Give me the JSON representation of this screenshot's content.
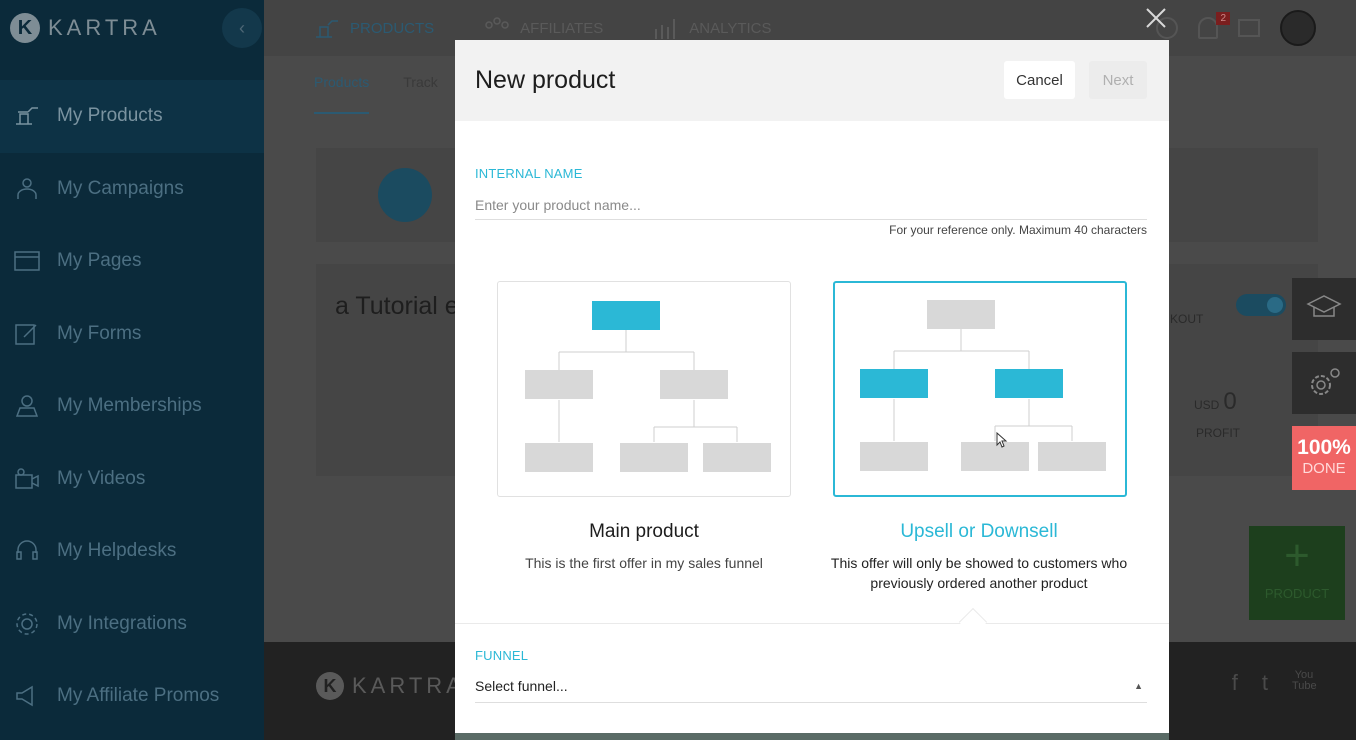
{
  "sidebar": {
    "logo_letter": "K",
    "logo_text": "KARTRA",
    "collapse_icon": "chevron-left-icon",
    "items": [
      {
        "label": "My Products",
        "icon": "products-icon",
        "active": true
      },
      {
        "label": "My Campaigns",
        "icon": "campaigns-icon"
      },
      {
        "label": "My Pages",
        "icon": "pages-icon"
      },
      {
        "label": "My Forms",
        "icon": "forms-icon"
      },
      {
        "label": "My Memberships",
        "icon": "memberships-icon"
      },
      {
        "label": "My Videos",
        "icon": "videos-icon"
      },
      {
        "label": "My Helpdesks",
        "icon": "helpdesk-icon"
      },
      {
        "label": "My Integrations",
        "icon": "integrations-icon"
      },
      {
        "label": "My Affiliate Promos",
        "icon": "affiliate-promos-icon"
      }
    ]
  },
  "topnav": {
    "items": [
      {
        "label": "PRODUCTS",
        "active": true
      },
      {
        "label": "AFFILIATES"
      },
      {
        "label": "ANALYTICS"
      }
    ],
    "notification_count": "2"
  },
  "background": {
    "subtabs": [
      "Products",
      "Track"
    ],
    "title": "a Tutorial e",
    "checkout_label": "KOUT",
    "currency": "USD",
    "profit_value": "0",
    "profit_label": "PROFIT",
    "add_product_plus": "+",
    "add_product_label": "PRODUCT",
    "footer_logo": "KARTRA",
    "footer_logo_letter": "K",
    "social": [
      "f",
      "t",
      "You Tube"
    ]
  },
  "widgets": {
    "done_percent": "100%",
    "done_label": "DONE"
  },
  "modal": {
    "title": "New product",
    "cancel_label": "Cancel",
    "next_label": "Next",
    "internal_name_label": "INTERNAL NAME",
    "internal_name_placeholder": "Enter your product name...",
    "internal_name_value": "",
    "internal_name_hint": "For your reference only. Maximum 40 characters",
    "options": [
      {
        "title": "Main product",
        "description": "This is the first offer in my sales funnel",
        "selected": false
      },
      {
        "title": "Upsell or Downsell",
        "description": "This offer will only be showed to customers who previously ordered another product",
        "selected": true
      }
    ],
    "funnel_label": "FUNNEL",
    "funnel_value": "Select funnel...",
    "colors": {
      "accent": "#2bb8d6",
      "box_gray": "#d8d8d8"
    }
  }
}
